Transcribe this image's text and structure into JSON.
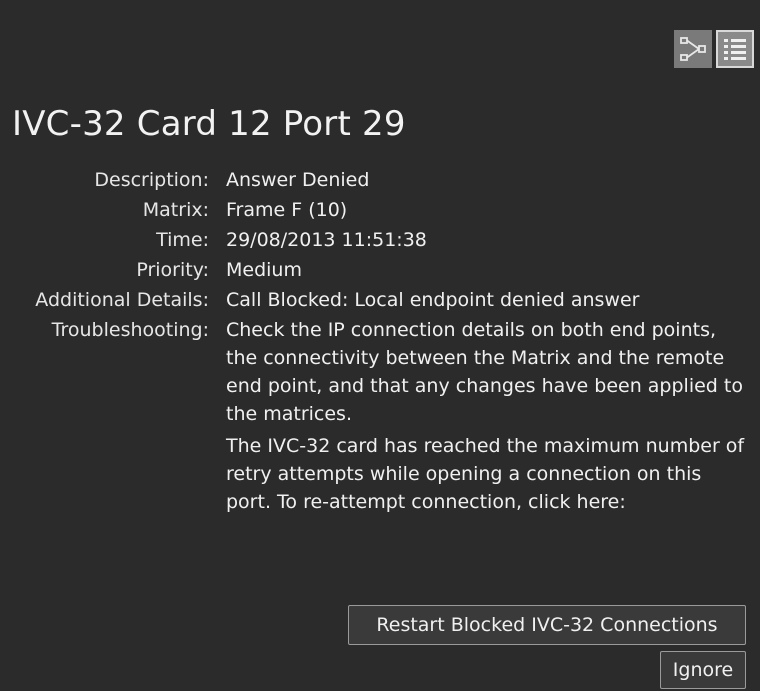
{
  "header": {
    "title": "IVC-32 Card 12 Port 29"
  },
  "view_toggle": {
    "graph_icon": "topology-graph-icon",
    "list_icon": "list-view-icon"
  },
  "details": {
    "description_label": "Description:",
    "description_value": "Answer Denied",
    "matrix_label": "Matrix:",
    "matrix_value": "Frame F (10)",
    "time_label": "Time:",
    "time_value": "29/08/2013 11:51:38",
    "priority_label": "Priority:",
    "priority_value": "Medium",
    "additional_label": "Additional Details:",
    "additional_value": "Call Blocked: Local endpoint denied answer",
    "troubleshooting_label": "Troubleshooting:",
    "troubleshooting_p1": "Check the IP connection details on both end points, the connectivity between the Matrix and the remote end point, and that any changes have been applied to the matrices.",
    "troubleshooting_p2": "The IVC-32 card has reached the maximum number of retry attempts while opening a connection on this port. To re-attempt connection, click here:"
  },
  "actions": {
    "restart_label": "Restart Blocked IVC-32 Connections",
    "ignore_label": "Ignore"
  },
  "colors": {
    "background": "#2b2b2b",
    "text": "#ececec",
    "button_border": "#9a9a9a"
  }
}
